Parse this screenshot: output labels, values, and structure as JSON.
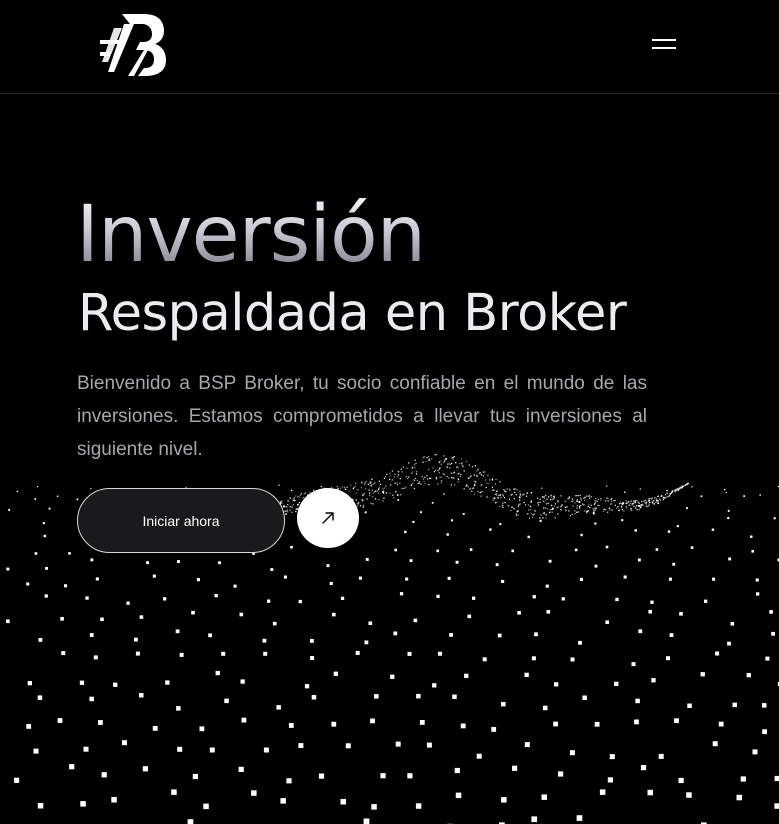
{
  "header": {
    "logo_alt": "BSP Broker",
    "menu_icon": "hamburger-menu-icon"
  },
  "hero": {
    "title": "Inversión",
    "subtitle": "Respaldada en Broker",
    "description": "Bienvenido a BSP Broker, tu socio confiable en el mundo de las inversiones. Estamos comprometidos a llevar tus inversiones al siguiente nivel.",
    "cta_label": "Iniciar ahora",
    "arrow_icon": "arrow-up-right-icon"
  },
  "colors": {
    "background": "#000000",
    "text_primary": "#ececf0",
    "text_secondary": "#a6a6ac",
    "button_dark": "#1a1a1c",
    "button_light": "#ffffff"
  }
}
